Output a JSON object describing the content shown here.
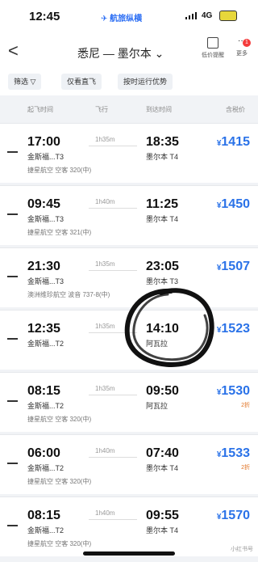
{
  "status_bar": {
    "time": "12:45",
    "carrier_center": "✈ 航旅纵横",
    "network": "4G"
  },
  "header": {
    "back": "<",
    "route": "悉尼 — 墨尔本 ⌄",
    "btn1_label": "低价提醒",
    "btn2_label": "更多",
    "badge": "1"
  },
  "filters": [
    "筛选 ▽",
    "仅看直飞",
    "按时运行优势"
  ],
  "columns": [
    "起飞时间",
    "飞行",
    "到达时间",
    "含税价"
  ],
  "flights": [
    {
      "dep": "17:00",
      "dep_ap": "金斯福...T3",
      "dur": "1h35m",
      "arr": "18:35",
      "arr_ap": "墨尔本 T4",
      "price": "1415",
      "note": "",
      "sub": "捷星航空  空客 320(中)"
    },
    {
      "dep": "09:45",
      "dep_ap": "金斯福...T3",
      "dur": "1h40m",
      "arr": "11:25",
      "arr_ap": "墨尔本 T4",
      "price": "1450",
      "note": "",
      "sub": "捷星航空  空客 321(中)"
    },
    {
      "dep": "21:30",
      "dep_ap": "金斯福...T3",
      "dur": "1h35m",
      "arr": "23:05",
      "arr_ap": "墨尔本 T3",
      "price": "1507",
      "note": "",
      "sub": "澳洲维珍航空  波音 737-8(中)"
    },
    {
      "dep": "12:35",
      "dep_ap": "金斯福...T2",
      "dur": "1h35m",
      "arr": "14:10",
      "arr_ap": "阿瓦拉",
      "price": "1523",
      "note": "",
      "sub": ""
    },
    {
      "dep": "08:15",
      "dep_ap": "金斯福...T2",
      "dur": "1h35m",
      "arr": "09:50",
      "arr_ap": "阿瓦拉",
      "price": "1530",
      "note": "2折",
      "sub": "捷星航空  空客 320(中)"
    },
    {
      "dep": "06:00",
      "dep_ap": "金斯福...T2",
      "dur": "1h40m",
      "arr": "07:40",
      "arr_ap": "墨尔本 T4",
      "price": "1533",
      "note": "2折",
      "sub": "捷星航空  空客 320(中)"
    },
    {
      "dep": "08:15",
      "dep_ap": "金斯福...T2",
      "dur": "1h40m",
      "arr": "09:55",
      "arr_ap": "墨尔本 T4",
      "price": "1570",
      "note": "",
      "sub": "捷星航空  空客 320(中)"
    }
  ],
  "currency": "¥",
  "watermark": "小红书号",
  "colors": {
    "price": "#2a72e8",
    "note": "#e0701f",
    "background": "#f1f3f6"
  }
}
